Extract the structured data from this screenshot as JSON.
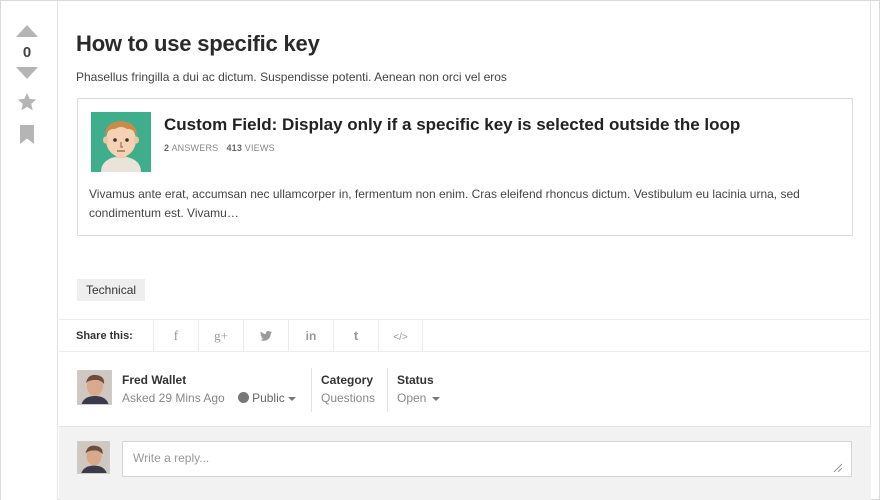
{
  "vote": {
    "count": "0"
  },
  "question": {
    "title": "How to use specific key",
    "body": "Phasellus fringilla a dui ac dictum. Suspendisse potenti. Aenean non orci vel eros"
  },
  "embed": {
    "title": "Custom Field: Display only if a specific key is selected outside the loop",
    "answers": "2",
    "answers_label": "ANSWERS",
    "views": "413",
    "views_label": "VIEWS",
    "excerpt": "Vivamus ante erat, accumsan nec ullamcorper in, fermentum non enim. Cras eleifend rhoncus dictum. Vestibulum eu lacinia urna, sed condimentum est. Vivamu…"
  },
  "tag": "Technical",
  "share": {
    "label": "Share this:",
    "icons": [
      "f",
      "g+",
      "twitter",
      "in",
      "t",
      "</>"
    ]
  },
  "meta": {
    "author": "Fred Wallet",
    "asked": "Asked 29 Mins Ago",
    "visibility": "Public",
    "category_label": "Category",
    "category": "Questions",
    "status_label": "Status",
    "status": "Open"
  },
  "reply": {
    "placeholder": "Write a reply..."
  },
  "colors": {
    "avatar_bg": "#3fae8c",
    "arrow": "#b5b5b5"
  }
}
